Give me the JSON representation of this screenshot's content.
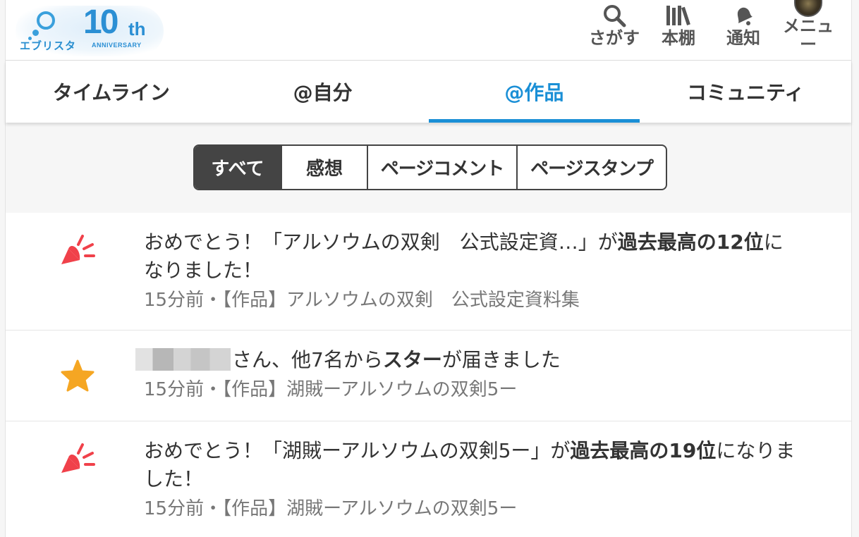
{
  "header": {
    "logo_name": "エブリスタ",
    "logo_ten": "10",
    "logo_th": "th",
    "logo_anniversary": "ANNIVERSARY",
    "nav": {
      "search": "さがす",
      "bookshelf": "本棚",
      "notifications": "通知",
      "menu": "メニュー"
    }
  },
  "tabs": [
    {
      "label": "タイムライン"
    },
    {
      "label": "@自分"
    },
    {
      "label": "@作品"
    },
    {
      "label": "コミュニティ"
    }
  ],
  "filters": [
    {
      "label": "すべて"
    },
    {
      "label": "感想"
    },
    {
      "label": "ページコメント"
    },
    {
      "label": "ページスタンプ"
    }
  ],
  "notifications": [
    {
      "icon": "party-popper-icon",
      "text_a": "おめでとう！「アルソウムの双剣　公式設定資…」が",
      "text_bold": "過去最高の12位",
      "text_b": "になりました！",
      "meta": "15分前・【作品】アルソウムの双剣　公式設定資料集"
    },
    {
      "icon": "star-icon",
      "text_a": "さん、他7名から",
      "text_bold": "スター",
      "text_b": "が届きました",
      "meta": "15分前・【作品】湖賊ーアルソウムの双剣5ー"
    },
    {
      "icon": "party-popper-icon",
      "text_a": "おめでとう！「湖賊ーアルソウムの双剣5ー」が",
      "text_bold": "過去最高の19位",
      "text_b": "になりました！",
      "meta": "15分前・【作品】湖賊ーアルソウムの双剣5ー"
    }
  ],
  "colors": {
    "accent": "#1a8fd6",
    "popper": "#f0414a",
    "star": "#f5a623"
  }
}
